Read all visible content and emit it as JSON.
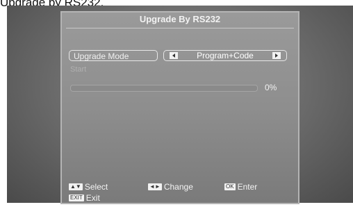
{
  "page": {
    "caption": "Upgrade by RS232."
  },
  "dialog": {
    "title": "Upgrade By RS232",
    "fields": {
      "upgrade_mode": {
        "label": "Upgrade Mode",
        "value": "Program+Code"
      },
      "start": {
        "label": "Start"
      }
    },
    "progress": {
      "percent_text": "0%",
      "value": 0
    }
  },
  "footer": {
    "select": {
      "key": "▲▼",
      "label": "Select"
    },
    "change": {
      "key": "◄►",
      "label": "Change"
    },
    "enter": {
      "key": "OK",
      "label": "Enter"
    },
    "exit": {
      "key": "EXIT",
      "label": "Exit"
    }
  }
}
